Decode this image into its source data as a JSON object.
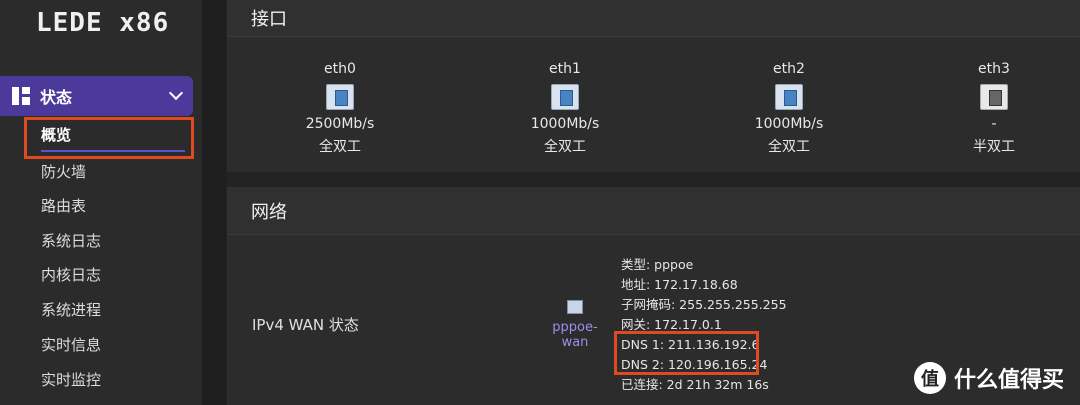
{
  "brand": "LEDE x86",
  "sidebar": {
    "section": "状态",
    "items": [
      {
        "label": "概览",
        "active": true
      },
      {
        "label": "防火墙"
      },
      {
        "label": "路由表"
      },
      {
        "label": "系统日志"
      },
      {
        "label": "内核日志"
      },
      {
        "label": "系统进程"
      },
      {
        "label": "实时信息"
      },
      {
        "label": "实时监控"
      }
    ]
  },
  "interfaces_card": {
    "title": "接口",
    "ports": [
      {
        "name": "eth0",
        "speed": "2500Mb/s",
        "duplex": "全双工",
        "icon": "ethernet-connected-icon"
      },
      {
        "name": "eth1",
        "speed": "1000Mb/s",
        "duplex": "全双工",
        "icon": "ethernet-connected-icon"
      },
      {
        "name": "eth2",
        "speed": "1000Mb/s",
        "duplex": "全双工",
        "icon": "ethernet-connected-icon"
      },
      {
        "name": "eth3",
        "speed": "-",
        "duplex": "半双工",
        "icon": "ethernet-disconnected-icon"
      }
    ]
  },
  "network_card": {
    "title": "网络",
    "wan_label": "IPv4 WAN 状态",
    "wan_interface": "pppoe-wan",
    "info": [
      "类型: pppoe",
      "地址: 172.17.18.68",
      "子网掩码: 255.255.255.255",
      "网关: 172.17.0.1",
      "DNS 1: 211.136.192.6",
      "DNS 2: 120.196.165.24",
      "已连接: 2d 21h 32m 16s"
    ]
  },
  "watermark": {
    "badge": "值",
    "text": "什么值得买"
  },
  "colors": {
    "accent": "#4b3a99",
    "highlight": "#e04a1f",
    "link": "#9b8fe8"
  }
}
